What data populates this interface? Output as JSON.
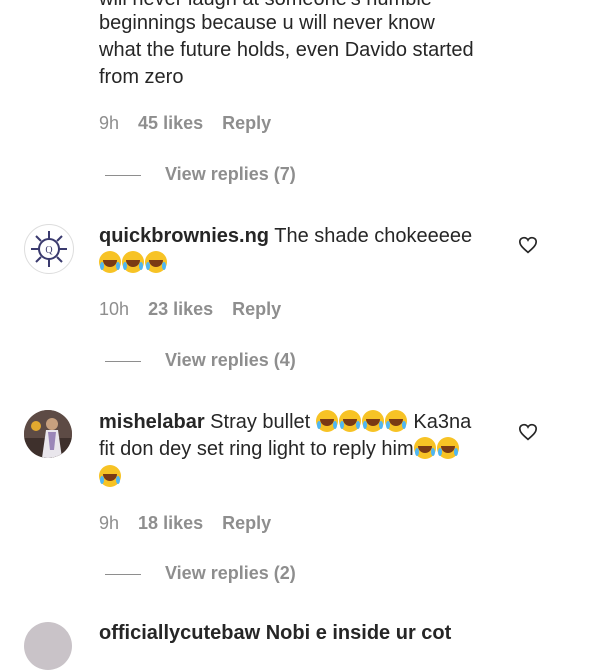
{
  "comment0": {
    "line1": "will never laugh at someone's humble",
    "line2": "beginnings because u will never know",
    "line3": "what the future holds, even Davido started",
    "line4": "from zero",
    "time": "9h",
    "likes": "45 likes",
    "reply": "Reply",
    "view_replies": "View replies (7)"
  },
  "comment1": {
    "username": "quickbrownies.ng",
    "text": "The shade chokeeeee",
    "emoji": "laughing-with-tears",
    "time": "10h",
    "likes": "23 likes",
    "reply": "Reply",
    "view_replies": "View replies (4)"
  },
  "comment2": {
    "username": "mishelabar",
    "text1": "Stray bullet",
    "text2": "Ka3na",
    "text3": "fit don dey set ring light to reply him",
    "emoji": "laughing-with-tears",
    "time": "9h",
    "likes": "18 likes",
    "reply": "Reply",
    "view_replies": "View replies (2)"
  },
  "comment3": {
    "partial": "officiallycutebaw  Nobi e inside ur cot"
  },
  "colors": {
    "text": "#262626",
    "muted": "#8e8e8e",
    "heart": "#262626"
  },
  "icons": [
    "heart-icon",
    "laughing-tears-emoji",
    "avatar"
  ]
}
